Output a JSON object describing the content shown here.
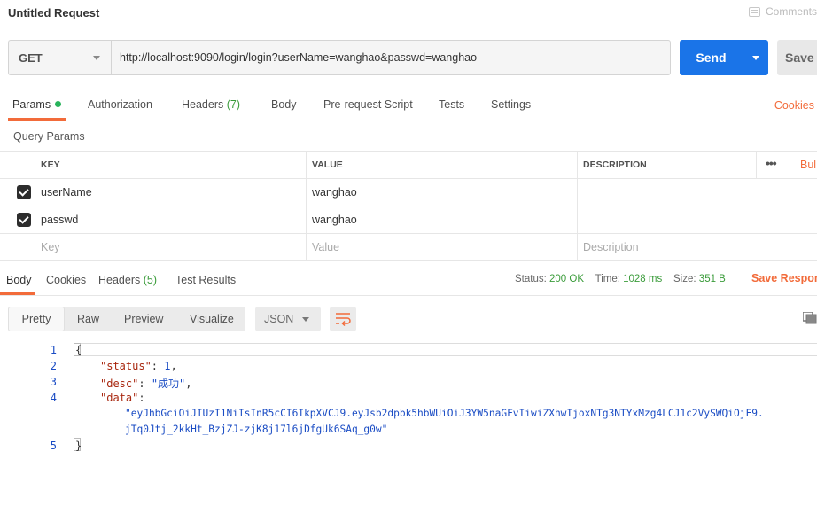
{
  "header": {
    "title": "Untitled Request",
    "comments_label": "Comments"
  },
  "request": {
    "method": "GET",
    "url": "http://localhost:9090/login/login?userName=wanghao&passwd=wanghao",
    "send_label": "Send",
    "save_label": "Save"
  },
  "request_tabs": {
    "params": "Params",
    "authorization": "Authorization",
    "headers": "Headers",
    "headers_count": "(7)",
    "body": "Body",
    "pre_request": "Pre-request Script",
    "tests": "Tests",
    "settings": "Settings",
    "cookies": "Cookies"
  },
  "query_params": {
    "title": "Query Params",
    "columns": {
      "key": "KEY",
      "value": "VALUE",
      "description": "DESCRIPTION"
    },
    "more": "•••",
    "bulk_edit": "Bul",
    "rows": [
      {
        "key": "userName",
        "value": "wanghao"
      },
      {
        "key": "passwd",
        "value": "wanghao"
      }
    ],
    "placeholders": {
      "key": "Key",
      "value": "Value",
      "description": "Description"
    }
  },
  "response_tabs": {
    "body": "Body",
    "cookies": "Cookies",
    "headers": "Headers",
    "headers_count": "(5)",
    "test_results": "Test Results"
  },
  "response_status": {
    "status_label": "Status:",
    "status_value": "200 OK",
    "time_label": "Time:",
    "time_value": "1028 ms",
    "size_label": "Size:",
    "size_value": "351 B",
    "save_response": "Save Respon"
  },
  "view_modes": {
    "pretty": "Pretty",
    "raw": "Raw",
    "preview": "Preview",
    "visualize": "Visualize",
    "format": "JSON"
  },
  "response_body": {
    "line_numbers": [
      "1",
      "2",
      "3",
      "4",
      "5"
    ],
    "open_brace": "{",
    "status_key": "\"status\"",
    "status_value": "1",
    "desc_key": "\"desc\"",
    "desc_value": "\"成功\"",
    "data_key": "\"data\"",
    "data_value_line1": "\"eyJhbGciOiJIUzI1NiIsInR5cCI6IkpXVCJ9.eyJsb2dpbk5hbWUiOiJ3YW5naGFvIiwiZXhwIjoxNTg3NTYxMzg4LCJ1c2VySWQiOjF9.",
    "data_value_line2": "jTq0Jtj_2kkHt_BzjZJ-zjK8j17l6jDfgUk6SAq_g0w\"",
    "close_brace": "}"
  },
  "colors": {
    "accent": "#f26b3a",
    "primary": "#1a74e8",
    "success": "#3b9c3b"
  }
}
